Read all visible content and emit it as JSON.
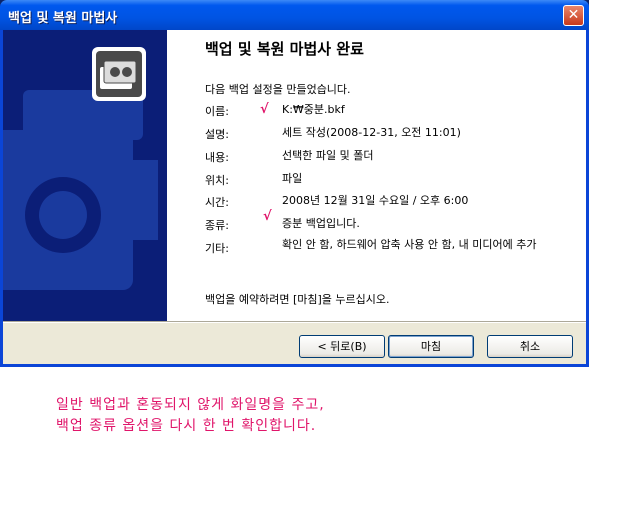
{
  "window": {
    "title": "백업 및 복원 마법사",
    "close_glyph": "✕"
  },
  "content": {
    "title": "백업 및 복원 마법사 완료",
    "intro": "다음 백업 설정을 만들었습니다.",
    "rows": [
      {
        "label": "이름:",
        "value": "K:₩중분.bkf"
      },
      {
        "label": "설명:",
        "value": "세트 작성(2008-12-31, 오전 11:01)"
      },
      {
        "label": "내용:",
        "value": "선택한 파일 및 폴더"
      },
      {
        "label": "위치:",
        "value": "파일"
      },
      {
        "label": "시간:",
        "value": "2008년 12월 31일 수요일 / 오후 6:00"
      },
      {
        "label": "종류:",
        "value": "증분 백업입니다."
      },
      {
        "label": "기타:",
        "value": "확인 안 함, 하드웨어 압축 사용 안 함, 내 미디어에 추가"
      }
    ],
    "footer_note": "백업을 예약하려면 [마침]을 누르십시오."
  },
  "buttons": {
    "back": "< 뒤로(B)",
    "finish": "마침",
    "cancel": "취소"
  },
  "annotation": {
    "check_mark": "√",
    "line1": "일반 백업과 혼동되지 않게 화일명을 주고,",
    "line2": "백업 종류 옵션을 다시 한 번 확인합니다."
  },
  "colors": {
    "titlebar": "#0054e3",
    "banner": "#0b1e77",
    "annotation": "#e0156a"
  }
}
